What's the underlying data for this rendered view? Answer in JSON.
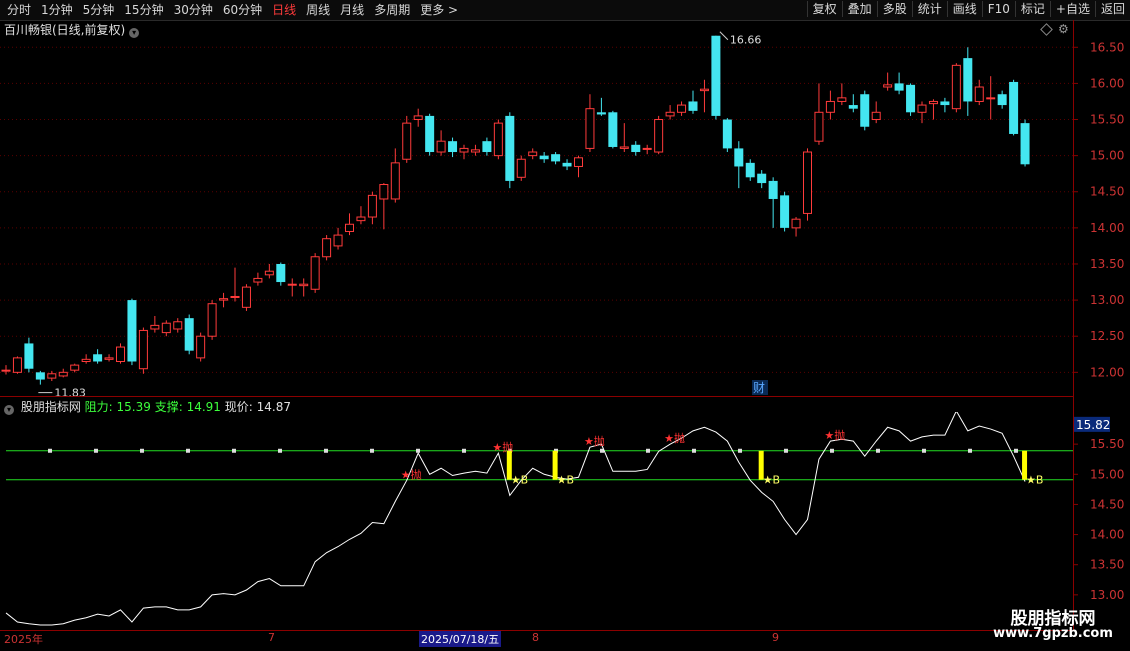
{
  "toolbar": {
    "periods": [
      "分时",
      "1分钟",
      "5分钟",
      "15分钟",
      "30分钟",
      "60分钟",
      "日线",
      "周线",
      "月线",
      "多周期",
      "更多 >"
    ],
    "active_period": "日线",
    "tools": [
      "复权",
      "叠加",
      "多股",
      "统计",
      "画线",
      "F10",
      "标记",
      "+自选",
      "返回"
    ]
  },
  "title": {
    "stock": "百川畅银(日线,前复权)"
  },
  "indicator": {
    "name": "股朋指标网",
    "resistance_label": "阻力: 15.39",
    "support_label": "支撑: 14.91",
    "current_label": "现价: 14.87",
    "current_value_tag": "15.82"
  },
  "price_axis": [
    "16.50",
    "16.00",
    "15.50",
    "15.00",
    "14.50",
    "14.00",
    "13.50",
    "13.00",
    "12.50",
    "12.00"
  ],
  "indicator_axis": [
    "15.50",
    "15.00",
    "14.50",
    "14.00",
    "13.50",
    "13.00"
  ],
  "annotations": {
    "high": "16.66",
    "low": "11.83",
    "cai": "财"
  },
  "dates": {
    "year": "2025年",
    "m7": "7",
    "selected": "2025/07/18/五",
    "m8": "8",
    "m9": "9"
  },
  "watermark": {
    "line1": "股朋指标网",
    "line2": "www.7gpzb.com"
  },
  "colors": {
    "up": "#ff3b3b",
    "down": "#44e6f0",
    "bg": "#000000",
    "axis": "#8b0000",
    "green": "#22dd22",
    "yellow": "#ffff00"
  },
  "chart_data": {
    "type": "candlestick",
    "y_range": [
      11.7,
      16.85
    ],
    "candles": [
      {
        "o": 12.02,
        "c": 12.03,
        "h": 12.1,
        "l": 11.97
      },
      {
        "o": 12.0,
        "c": 12.2,
        "h": 12.22,
        "l": 11.98
      },
      {
        "o": 12.4,
        "c": 12.05,
        "h": 12.48,
        "l": 12.0
      },
      {
        "o": 12.0,
        "c": 11.9,
        "h": 12.02,
        "l": 11.83
      },
      {
        "o": 11.92,
        "c": 11.98,
        "h": 12.02,
        "l": 11.88
      },
      {
        "o": 11.95,
        "c": 12.0,
        "h": 12.05,
        "l": 11.93
      },
      {
        "o": 12.03,
        "c": 12.1,
        "h": 12.12,
        "l": 12.0
      },
      {
        "o": 12.15,
        "c": 12.18,
        "h": 12.25,
        "l": 12.12
      },
      {
        "o": 12.25,
        "c": 12.15,
        "h": 12.32,
        "l": 12.12
      },
      {
        "o": 12.18,
        "c": 12.2,
        "h": 12.25,
        "l": 12.15
      },
      {
        "o": 12.15,
        "c": 12.35,
        "h": 12.4,
        "l": 12.12
      },
      {
        "o": 13.0,
        "c": 12.15,
        "h": 13.02,
        "l": 12.1
      },
      {
        "o": 12.05,
        "c": 12.58,
        "h": 12.62,
        "l": 11.98
      },
      {
        "o": 12.6,
        "c": 12.65,
        "h": 12.78,
        "l": 12.55
      },
      {
        "o": 12.55,
        "c": 12.68,
        "h": 12.72,
        "l": 12.5
      },
      {
        "o": 12.6,
        "c": 12.7,
        "h": 12.75,
        "l": 12.55
      },
      {
        "o": 12.75,
        "c": 12.3,
        "h": 12.8,
        "l": 12.25
      },
      {
        "o": 12.2,
        "c": 12.5,
        "h": 12.55,
        "l": 12.15
      },
      {
        "o": 12.5,
        "c": 12.95,
        "h": 13.0,
        "l": 12.45
      },
      {
        "o": 13.0,
        "c": 13.02,
        "h": 13.1,
        "l": 12.9
      },
      {
        "o": 13.05,
        "c": 13.05,
        "h": 13.45,
        "l": 12.98
      },
      {
        "o": 12.9,
        "c": 13.18,
        "h": 13.22,
        "l": 12.85
      },
      {
        "o": 13.25,
        "c": 13.3,
        "h": 13.38,
        "l": 13.2
      },
      {
        "o": 13.35,
        "c": 13.4,
        "h": 13.5,
        "l": 13.3
      },
      {
        "o": 13.5,
        "c": 13.25,
        "h": 13.52,
        "l": 13.2
      },
      {
        "o": 13.22,
        "c": 13.22,
        "h": 13.3,
        "l": 13.05
      },
      {
        "o": 13.2,
        "c": 13.22,
        "h": 13.3,
        "l": 13.05
      },
      {
        "o": 13.15,
        "c": 13.6,
        "h": 13.65,
        "l": 13.1
      },
      {
        "o": 13.6,
        "c": 13.85,
        "h": 13.9,
        "l": 13.55
      },
      {
        "o": 13.75,
        "c": 13.9,
        "h": 14.0,
        "l": 13.7
      },
      {
        "o": 13.95,
        "c": 14.05,
        "h": 14.2,
        "l": 13.9
      },
      {
        "o": 14.1,
        "c": 14.15,
        "h": 14.3,
        "l": 14.05
      },
      {
        "o": 14.15,
        "c": 14.45,
        "h": 14.5,
        "l": 14.05
      },
      {
        "o": 14.4,
        "c": 14.6,
        "h": 14.62,
        "l": 13.98
      },
      {
        "o": 14.4,
        "c": 14.9,
        "h": 15.1,
        "l": 14.35
      },
      {
        "o": 14.95,
        "c": 15.45,
        "h": 15.55,
        "l": 14.9
      },
      {
        "o": 15.5,
        "c": 15.55,
        "h": 15.65,
        "l": 15.4
      },
      {
        "o": 15.55,
        "c": 15.05,
        "h": 15.58,
        "l": 15.0
      },
      {
        "o": 15.05,
        "c": 15.2,
        "h": 15.35,
        "l": 15.0
      },
      {
        "o": 15.2,
        "c": 15.05,
        "h": 15.25,
        "l": 14.98
      },
      {
        "o": 15.05,
        "c": 15.1,
        "h": 15.15,
        "l": 14.95
      },
      {
        "o": 15.05,
        "c": 15.08,
        "h": 15.15,
        "l": 15.0
      },
      {
        "o": 15.2,
        "c": 15.05,
        "h": 15.25,
        "l": 15.0
      },
      {
        "o": 15.0,
        "c": 15.45,
        "h": 15.5,
        "l": 14.95
      },
      {
        "o": 15.55,
        "c": 14.65,
        "h": 15.6,
        "l": 14.55
      },
      {
        "o": 14.7,
        "c": 14.95,
        "h": 15.0,
        "l": 14.65
      },
      {
        "o": 15.0,
        "c": 15.05,
        "h": 15.1,
        "l": 14.95
      },
      {
        "o": 15.0,
        "c": 14.95,
        "h": 15.05,
        "l": 14.9
      },
      {
        "o": 15.02,
        "c": 14.92,
        "h": 15.05,
        "l": 14.88
      },
      {
        "o": 14.9,
        "c": 14.85,
        "h": 14.95,
        "l": 14.8
      },
      {
        "o": 14.85,
        "c": 14.97,
        "h": 15.0,
        "l": 14.7
      },
      {
        "o": 15.1,
        "c": 15.65,
        "h": 15.85,
        "l": 15.05
      },
      {
        "o": 15.6,
        "c": 15.57,
        "h": 15.8,
        "l": 15.55
      },
      {
        "o": 15.6,
        "c": 15.12,
        "h": 15.62,
        "l": 15.1
      },
      {
        "o": 15.1,
        "c": 15.12,
        "h": 15.45,
        "l": 15.05
      },
      {
        "o": 15.15,
        "c": 15.05,
        "h": 15.2,
        "l": 15.0
      },
      {
        "o": 15.1,
        "c": 15.1,
        "h": 15.15,
        "l": 15.02
      },
      {
        "o": 15.05,
        "c": 15.5,
        "h": 15.55,
        "l": 15.02
      },
      {
        "o": 15.55,
        "c": 15.6,
        "h": 15.7,
        "l": 15.5
      },
      {
        "o": 15.6,
        "c": 15.7,
        "h": 15.75,
        "l": 15.55
      },
      {
        "o": 15.75,
        "c": 15.62,
        "h": 15.9,
        "l": 15.58
      },
      {
        "o": 15.9,
        "c": 15.92,
        "h": 16.05,
        "l": 15.6
      },
      {
        "o": 16.66,
        "c": 15.55,
        "h": 16.66,
        "l": 15.5
      },
      {
        "o": 15.5,
        "c": 15.1,
        "h": 15.52,
        "l": 15.05
      },
      {
        "o": 15.1,
        "c": 14.85,
        "h": 15.2,
        "l": 14.55
      },
      {
        "o": 14.9,
        "c": 14.7,
        "h": 14.95,
        "l": 14.65
      },
      {
        "o": 14.75,
        "c": 14.62,
        "h": 14.8,
        "l": 14.55
      },
      {
        "o": 14.65,
        "c": 14.4,
        "h": 14.7,
        "l": 14.0
      },
      {
        "o": 14.45,
        "c": 14.0,
        "h": 14.5,
        "l": 13.95
      },
      {
        "o": 14.0,
        "c": 14.12,
        "h": 14.15,
        "l": 13.88
      },
      {
        "o": 14.2,
        "c": 15.05,
        "h": 15.1,
        "l": 14.1
      },
      {
        "o": 15.2,
        "c": 15.6,
        "h": 16.0,
        "l": 15.15
      },
      {
        "o": 15.6,
        "c": 15.75,
        "h": 15.9,
        "l": 15.5
      },
      {
        "o": 15.75,
        "c": 15.8,
        "h": 16.0,
        "l": 15.7
      },
      {
        "o": 15.7,
        "c": 15.65,
        "h": 15.85,
        "l": 15.6
      },
      {
        "o": 15.85,
        "c": 15.4,
        "h": 15.9,
        "l": 15.35
      },
      {
        "o": 15.5,
        "c": 15.6,
        "h": 15.75,
        "l": 15.45
      },
      {
        "o": 15.95,
        "c": 15.98,
        "h": 16.15,
        "l": 15.9
      },
      {
        "o": 16.0,
        "c": 15.9,
        "h": 16.15,
        "l": 15.85
      },
      {
        "o": 15.98,
        "c": 15.6,
        "h": 16.0,
        "l": 15.55
      },
      {
        "o": 15.6,
        "c": 15.7,
        "h": 15.75,
        "l": 15.45
      },
      {
        "o": 15.72,
        "c": 15.75,
        "h": 15.78,
        "l": 15.5
      },
      {
        "o": 15.75,
        "c": 15.7,
        "h": 15.8,
        "l": 15.6
      },
      {
        "o": 15.65,
        "c": 16.25,
        "h": 16.28,
        "l": 15.6
      },
      {
        "o": 16.35,
        "c": 15.75,
        "h": 16.5,
        "l": 15.55
      },
      {
        "o": 15.75,
        "c": 15.95,
        "h": 16.05,
        "l": 15.7
      },
      {
        "o": 15.8,
        "c": 15.8,
        "h": 16.1,
        "l": 15.5
      },
      {
        "o": 15.85,
        "c": 15.7,
        "h": 15.9,
        "l": 15.65
      },
      {
        "o": 16.02,
        "c": 15.3,
        "h": 16.05,
        "l": 15.28
      },
      {
        "o": 15.45,
        "c": 14.88,
        "h": 15.5,
        "l": 14.85
      }
    ]
  },
  "indicator_data": {
    "y_range": [
      12.45,
      16.0
    ],
    "resistance": 15.39,
    "support": 14.91,
    "line": [
      12.7,
      12.55,
      12.52,
      12.5,
      12.5,
      12.52,
      12.58,
      12.62,
      12.68,
      12.65,
      12.75,
      12.55,
      12.78,
      12.8,
      12.8,
      12.75,
      12.75,
      12.8,
      13.0,
      13.02,
      13.0,
      13.08,
      13.22,
      13.27,
      13.15,
      13.15,
      13.15,
      13.55,
      13.7,
      13.8,
      13.92,
      14.02,
      14.2,
      14.18,
      14.55,
      14.9,
      15.35,
      15.0,
      15.1,
      14.98,
      15.02,
      15.05,
      15.02,
      15.35,
      14.65,
      14.9,
      15.1,
      15.0,
      14.95,
      14.92,
      14.95,
      15.45,
      15.5,
      15.05,
      15.05,
      15.05,
      15.08,
      15.38,
      15.5,
      15.6,
      15.72,
      15.78,
      15.7,
      15.55,
      15.2,
      14.9,
      14.7,
      14.55,
      14.25,
      14.0,
      14.25,
      15.25,
      15.55,
      15.58,
      15.55,
      15.3,
      15.55,
      15.78,
      15.72,
      15.55,
      15.62,
      15.65,
      15.65,
      16.05,
      15.72,
      15.8,
      15.75,
      15.68,
      15.3,
      14.88
    ],
    "signals": [
      {
        "type": "sell",
        "label": "抛",
        "i": 35
      },
      {
        "type": "sell",
        "label": "抛",
        "i": 43
      },
      {
        "type": "buy",
        "label": "B",
        "i": 44
      },
      {
        "type": "buy",
        "label": "B",
        "i": 48
      },
      {
        "type": "sell",
        "label": "抛",
        "i": 51
      },
      {
        "type": "sell",
        "label": "抛",
        "i": 58
      },
      {
        "type": "buy",
        "label": "B",
        "i": 66
      },
      {
        "type": "sell",
        "label": "抛",
        "i": 72
      },
      {
        "type": "buy",
        "label": "B",
        "i": 89
      }
    ]
  }
}
